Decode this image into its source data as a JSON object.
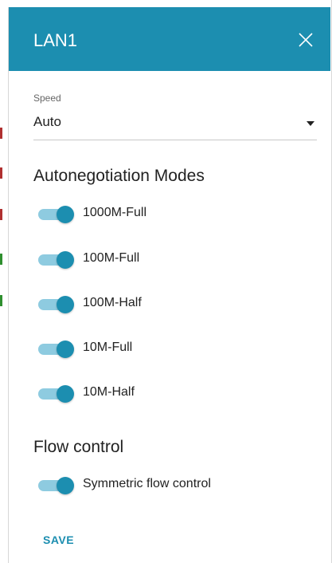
{
  "dialog": {
    "title": "LAN1"
  },
  "speed": {
    "label": "Speed",
    "value": "Auto"
  },
  "autoneg": {
    "title": "Autonegotiation Modes",
    "modes": [
      {
        "label": "1000M-Full",
        "on": true
      },
      {
        "label": "100M-Full",
        "on": true
      },
      {
        "label": "100M-Half",
        "on": true
      },
      {
        "label": "10M-Full",
        "on": true
      },
      {
        "label": "10M-Half",
        "on": true
      }
    ]
  },
  "flow": {
    "title": "Flow control",
    "symmetric_label": "Symmetric flow control",
    "symmetric_on": true
  },
  "actions": {
    "save_label": "SAVE"
  },
  "colors": {
    "accent": "#1c8eb0",
    "toggle_track": "#8ecbe0",
    "text": "#222222"
  },
  "icons": {
    "close": "close-icon",
    "dropdown": "chevron-down-icon"
  }
}
